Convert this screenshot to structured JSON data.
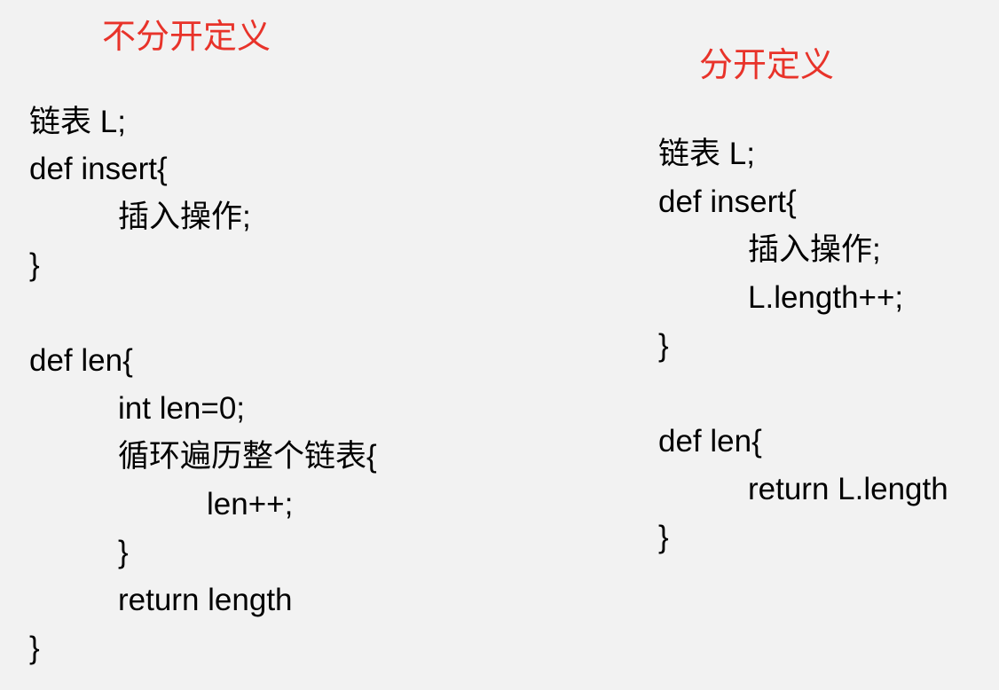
{
  "left_panel": {
    "heading": "不分开定义",
    "lines": [
      "链表 L;",
      "def insert{",
      "插入操作;",
      "}",
      "def len{",
      "int len=0;",
      "循环遍历整个链表{",
      "len++;",
      "}",
      "return length",
      "}"
    ]
  },
  "right_panel": {
    "heading": "分开定义",
    "lines": [
      "链表 L;",
      "def insert{",
      "插入操作;",
      "L.length++;",
      "}",
      "def len{",
      "return L.length",
      "}"
    ]
  },
  "colors": {
    "background": "#f2f2f2",
    "heading": "#e8332a",
    "code": "#000000"
  }
}
